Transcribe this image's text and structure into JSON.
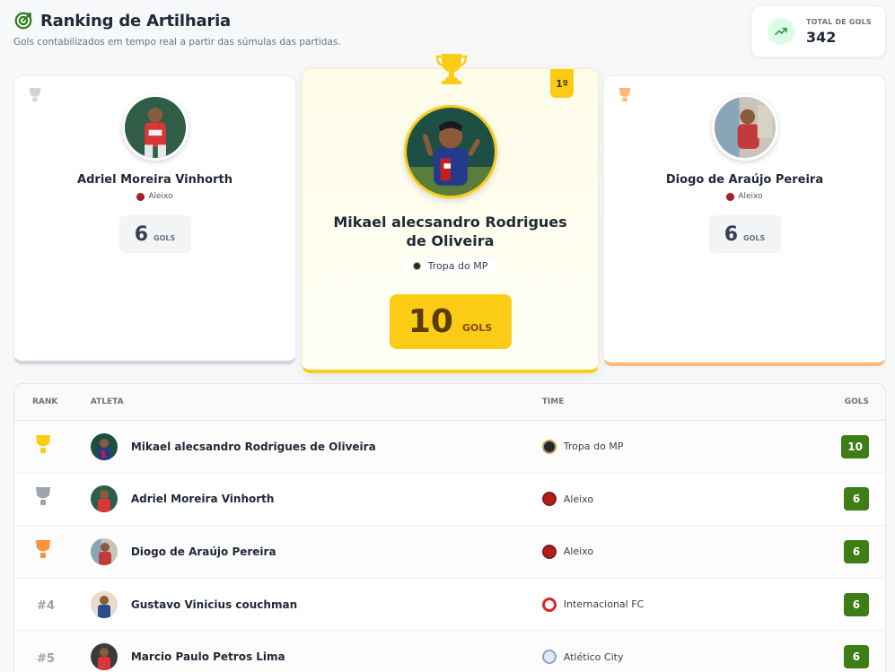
{
  "header": {
    "title": "Ranking de Artilharia",
    "subtitle": "Gols contabilizados em tempo real a partir das súmulas das partidas.",
    "icon": "target-icon"
  },
  "total": {
    "label": "TOTAL DE GOLS",
    "value": "342",
    "icon": "trending-up-icon"
  },
  "podium": {
    "first": {
      "rank_label": "1º",
      "name": "Mikael alecsandro Rodrigues de Oliveira",
      "team": "Tropa do MP",
      "goals": "10",
      "goals_label": "GOLS"
    },
    "second": {
      "name": "Adriel Moreira Vinhorth",
      "team": "Aleixo",
      "goals": "6",
      "goals_label": "GOLS"
    },
    "third": {
      "name": "Diogo de Araújo Pereira",
      "team": "Aleixo",
      "goals": "6",
      "goals_label": "GOLS"
    }
  },
  "table": {
    "headers": {
      "rank": "RANK",
      "athlete": "ATLETA",
      "team": "TIME",
      "goals": "GOLS"
    },
    "rows": [
      {
        "rank": "",
        "medal": "gold",
        "name": "Mikael alecsandro Rodrigues de Oliveira",
        "team": "Tropa do MP",
        "goals": "10"
      },
      {
        "rank": "",
        "medal": "silver",
        "name": "Adriel Moreira Vinhorth",
        "team": "Aleixo",
        "goals": "6"
      },
      {
        "rank": "",
        "medal": "bronze",
        "name": "Diogo de Araújo Pereira",
        "team": "Aleixo",
        "goals": "6"
      },
      {
        "rank": "#4",
        "medal": "",
        "name": "Gustavo Vinicius couchman",
        "team": "Internacional FC",
        "goals": "6"
      },
      {
        "rank": "#5",
        "medal": "",
        "name": "Marcio Paulo Petros Lima",
        "team": "Atlético City",
        "goals": "6"
      }
    ]
  },
  "colors": {
    "gold": "#facc15",
    "silver": "#9ca3af",
    "bronze": "#fb923c",
    "goal_badge": "#3f7d16",
    "trend_bg": "#dcfce7"
  }
}
